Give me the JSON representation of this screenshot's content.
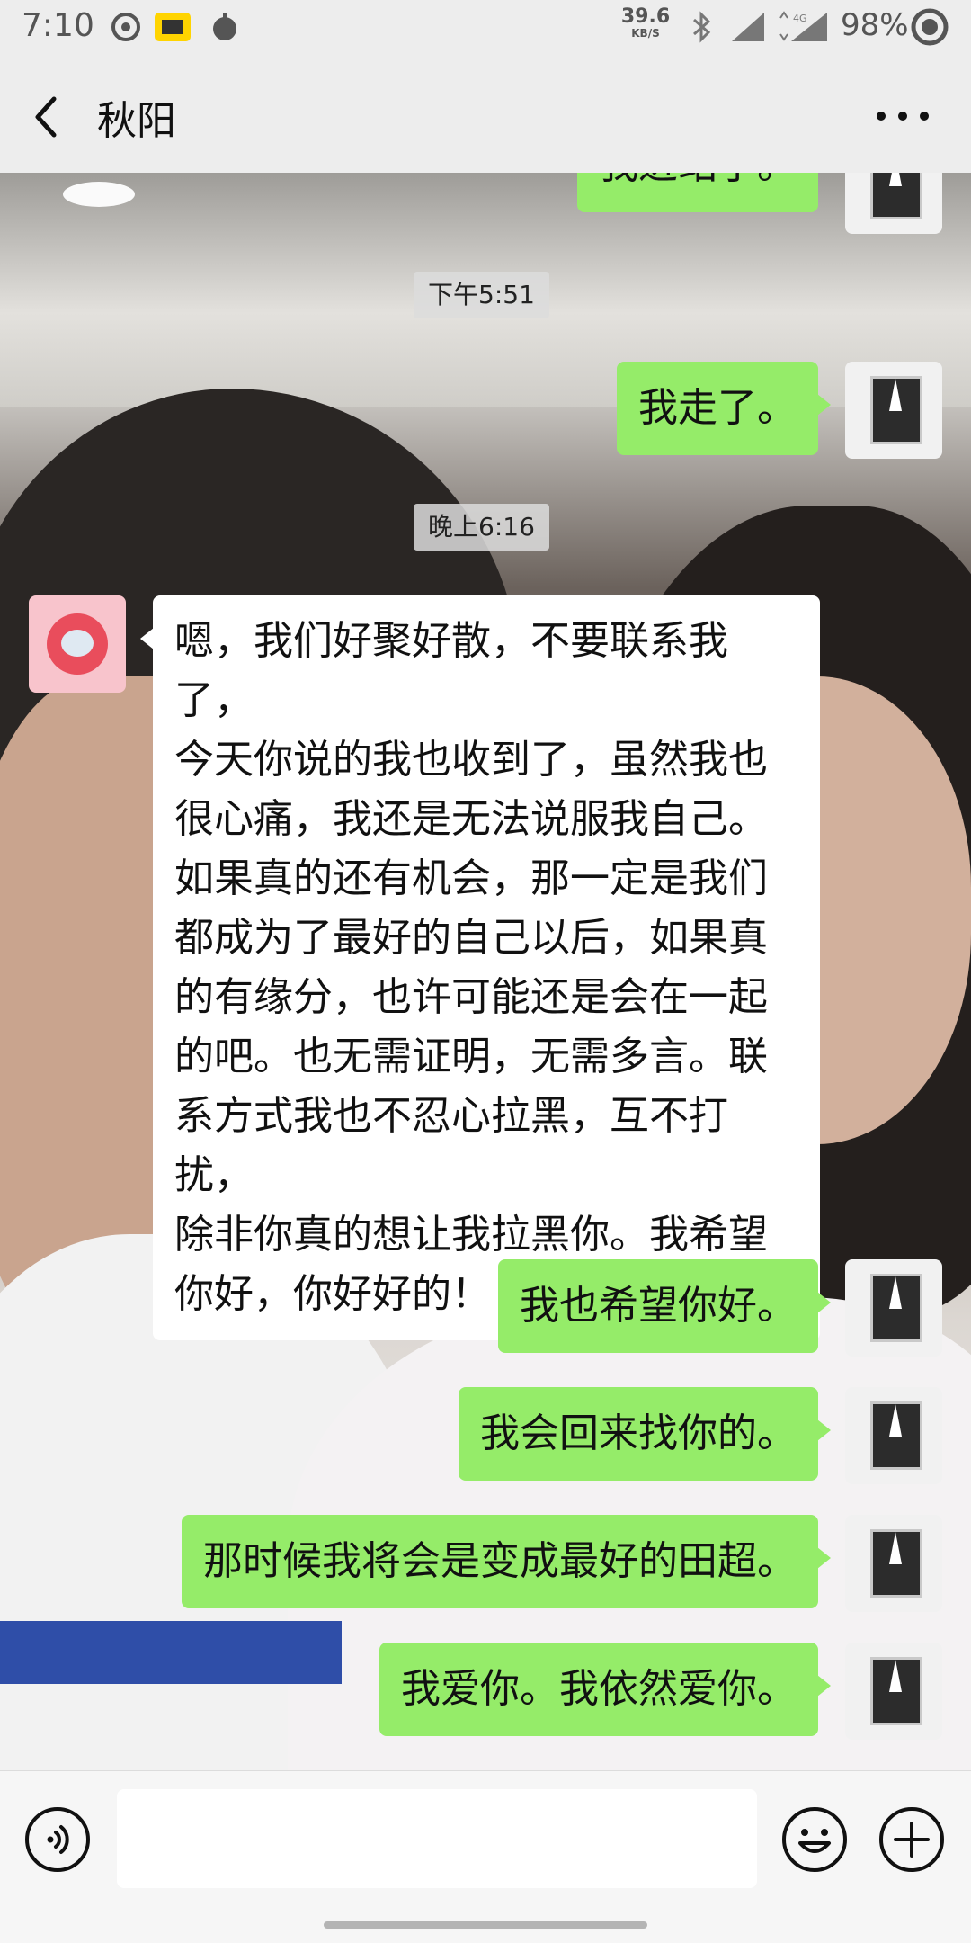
{
  "status_bar": {
    "time": "7:10",
    "net_speed": "39.6",
    "net_speed_unit": "KB/S",
    "network_type": "4G",
    "battery": "98%"
  },
  "header": {
    "title": "秋阳"
  },
  "messages": [
    {
      "type": "out",
      "text": "我进站了。"
    },
    {
      "type": "time",
      "text": "下午5:51"
    },
    {
      "type": "out",
      "text": "我走了。"
    },
    {
      "type": "time",
      "text": "晚上6:16"
    },
    {
      "type": "in",
      "lines": [
        "嗯，我们好聚好散，不要联系我了，",
        "今天你说的我也收到了，虽然我也",
        "很心痛，我还是无法说服我自己。",
        "如果真的还有机会，那一定是我们",
        "都成为了最好的自己以后，如果真",
        "的有缘分，也许可能还是会在一起",
        "的吧。也无需证明，无需多言。联",
        "系方式我也不忍心拉黑，互不打扰，",
        "除非你真的想让我拉黑你。我希望",
        "你好，你好好的！"
      ]
    },
    {
      "type": "out",
      "text": "我也希望你好。"
    },
    {
      "type": "out",
      "text": "我会回来找你的。"
    },
    {
      "type": "out",
      "text": "那时候我将会是变成最好的田超。"
    },
    {
      "type": "out",
      "text": "我爱你。我依然爱你。"
    }
  ],
  "input": {
    "value": "",
    "placeholder": ""
  },
  "colors": {
    "outgoing_bubble": "#95ec69",
    "incoming_bubble": "#ffffff",
    "header_bg": "#ededed"
  },
  "icons": {
    "back": "chevron-left-icon",
    "more": "more-dots-icon",
    "voice": "voice-icon",
    "emoji": "emoji-icon",
    "plus": "plus-icon"
  }
}
